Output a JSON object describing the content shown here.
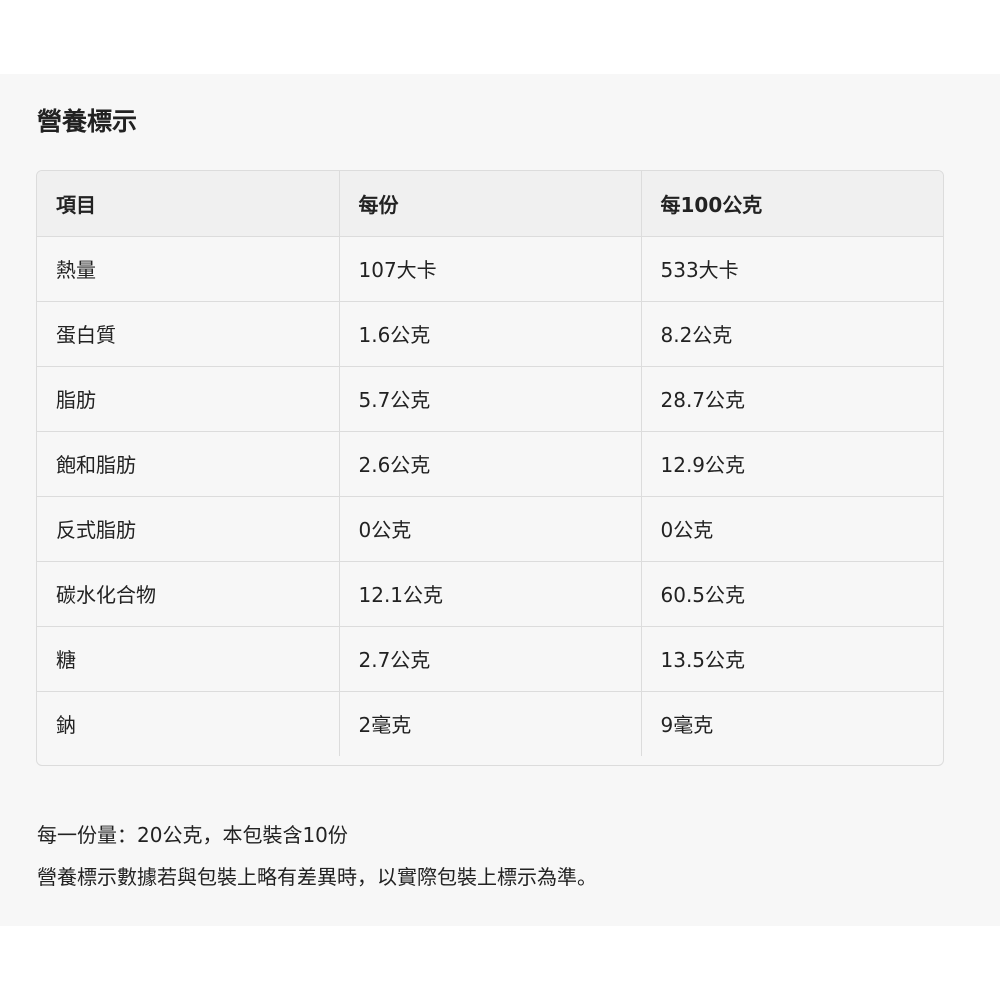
{
  "title": "營養標示",
  "table": {
    "headers": [
      "項目",
      "每份",
      "每100公克"
    ],
    "rows": [
      [
        "熱量",
        "107大卡",
        "533大卡"
      ],
      [
        "蛋白質",
        "1.6公克",
        "8.2公克"
      ],
      [
        "脂肪",
        "5.7公克",
        "28.7公克"
      ],
      [
        "飽和脂肪",
        "2.6公克",
        "12.9公克"
      ],
      [
        "反式脂肪",
        "0公克",
        "0公克"
      ],
      [
        "碳水化合物",
        "12.1公克",
        "60.5公克"
      ],
      [
        "糖",
        "2.7公克",
        "13.5公克"
      ],
      [
        "鈉",
        "2毫克",
        "9毫克"
      ]
    ]
  },
  "notes": {
    "serving": "每一份量：20公克，本包裝含10份",
    "disclaimer": "營養標示數據若與包裝上略有差異時，以實際包裝上標示為準。"
  }
}
